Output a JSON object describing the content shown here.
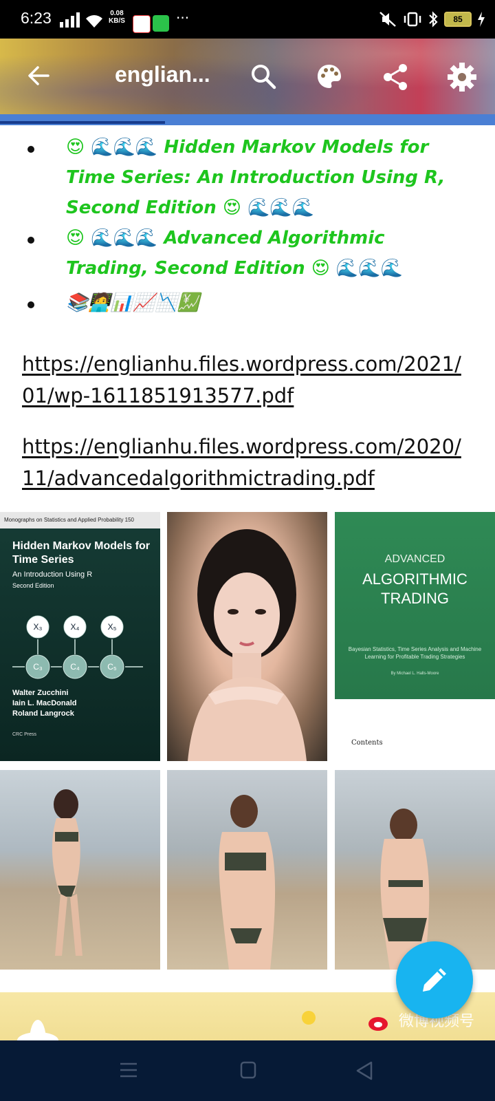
{
  "status_bar": {
    "time": "6:23",
    "net_speed_value": "0.08",
    "net_speed_unit": "KB/S",
    "more": "···",
    "battery": "85"
  },
  "app_bar": {
    "title": "englian...",
    "icons": [
      "back-icon",
      "search-icon",
      "palette-icon",
      "share-icon",
      "gear-icon"
    ]
  },
  "books": [
    {
      "prefix_emoji": "😍 🌊🌊🌊",
      "title": "Hidden Markov Models for Time Series: An Introduction Using R, Second Edition",
      "suffix_emoji": "😍 🌊🌊🌊"
    },
    {
      "prefix_emoji": "😍 🌊🌊🌊",
      "title": "Advanced Algorithmic Trading, Second Edition",
      "suffix_emoji": "😍 🌊🌊🌊"
    }
  ],
  "emoji_row": "📚🧑‍💻📊📈📉💹",
  "links": [
    "https://englianhu.files.wordpress.com/2021/01/wp-1611851913577.pdf",
    "https://englianhu.files.wordpress.com/2020/11/advancedalgorithmictrading.pdf"
  ],
  "covers": {
    "hmm": {
      "series": "Monographs on Statistics and Applied Probability 150",
      "title": "Hidden Markov Models for Time Series",
      "subtitle": "An Introduction Using R",
      "edition": "Second Edition",
      "x_nodes": [
        "X₃",
        "X₄",
        "X₅"
      ],
      "c_nodes": [
        "C₃",
        "C₄",
        "C₅"
      ],
      "authors": [
        "Walter Zucchini",
        "Iain L. MacDonald",
        "Roland Langrock"
      ],
      "publisher": "CRC Press"
    },
    "aat": {
      "line1": "ADVANCED",
      "line2": "ALGORITHMIC",
      "line3": "TRADING",
      "tagline": "Bayesian Statistics, Time Series Analysis and Machine Learning for Profitable Trading Strategies",
      "author": "By Michael L. Halls-Moore",
      "contents": "Contents"
    }
  },
  "banner": {
    "watermark": "微博视频号"
  },
  "fab": {
    "icon": "pencil-icon"
  },
  "nav_bar": {
    "icons": [
      "menu-icon",
      "home-square-icon",
      "back-triangle-icon"
    ]
  },
  "colors": {
    "book_title": "#1ec51e",
    "fab": "#18b4f0",
    "progress": "#4a7fd4",
    "nav_bar": "#061a36"
  }
}
